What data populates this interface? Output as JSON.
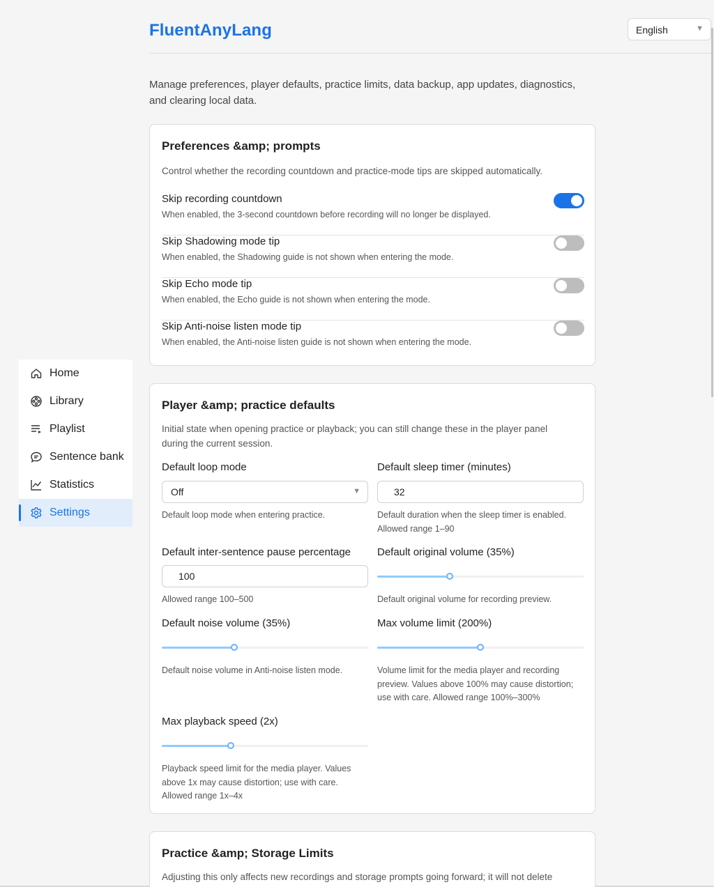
{
  "app": {
    "title": "FluentAnyLang"
  },
  "language_select": {
    "value": "English"
  },
  "sidebar": {
    "items": [
      {
        "label": "Home",
        "icon": "home-icon"
      },
      {
        "label": "Library",
        "icon": "film-reel-icon"
      },
      {
        "label": "Playlist",
        "icon": "playlist-icon"
      },
      {
        "label": "Sentence bank",
        "icon": "chat-bubble-icon"
      },
      {
        "label": "Statistics",
        "icon": "line-chart-icon"
      },
      {
        "label": "Settings",
        "icon": "gear-icon",
        "active": true
      }
    ]
  },
  "intro": "Manage preferences, player defaults, practice limits, data backup, app updates, diagnostics, and clearing local data.",
  "preferences": {
    "title": "Preferences &amp; prompts",
    "description": "Control whether the recording countdown and practice-mode tips are skipped automatically.",
    "items": [
      {
        "label": "Skip recording countdown",
        "help": "When enabled, the 3-second countdown before recording will no longer be displayed.",
        "enabled": true
      },
      {
        "label": "Skip Shadowing mode tip",
        "help": "When enabled, the Shadowing guide is not shown when entering the mode.",
        "enabled": false
      },
      {
        "label": "Skip Echo mode tip",
        "help": "When enabled, the Echo guide is not shown when entering the mode.",
        "enabled": false
      },
      {
        "label": "Skip Anti-noise listen mode tip",
        "help": "When enabled, the Anti-noise listen guide is not shown when entering the mode.",
        "enabled": false
      }
    ]
  },
  "player_defaults": {
    "title": "Player &amp; practice defaults",
    "description": "Initial state when opening practice or playback; you can still change these in the player panel during the current session.",
    "loop_mode": {
      "label": "Default loop mode",
      "value": "Off",
      "help": "Default loop mode when entering practice."
    },
    "sleep_timer": {
      "label": "Default sleep timer (minutes)",
      "value": "32",
      "help": "Default duration when the sleep timer is enabled. Allowed range 1–90"
    },
    "pause_percentage": {
      "label": "Default inter-sentence pause percentage",
      "value": "100",
      "help": "Allowed range 100–500"
    },
    "original_volume": {
      "label": "Default original volume (35%)",
      "percent": 35,
      "help": "Default original volume for recording preview."
    },
    "noise_volume": {
      "label": "Default noise volume (35%)",
      "percent": 35,
      "help": "Default noise volume in Anti-noise listen mode."
    },
    "max_volume": {
      "label": "Max volume limit (200%)",
      "value": 200,
      "min": 0,
      "max": 400,
      "help": "Volume limit for the media player and recording preview. Values above 100% may cause distortion; use with care. Allowed range 100%–300%"
    },
    "max_speed": {
      "label": "Max playback speed (2x)",
      "value": 2,
      "min": 0,
      "max": 6,
      "help": "Playback speed limit for the media player. Values above 1x may cause distortion; use with care. Allowed range 1x–4x"
    }
  },
  "practice_limits": {
    "title": "Practice &amp; Storage Limits",
    "description": "Adjusting this only affects new recordings and storage prompts going forward; it will not delete"
  },
  "colors": {
    "accent": "#1a73e8",
    "slider_fill": "#91caff",
    "toggle_off": "#bdbdbd"
  }
}
